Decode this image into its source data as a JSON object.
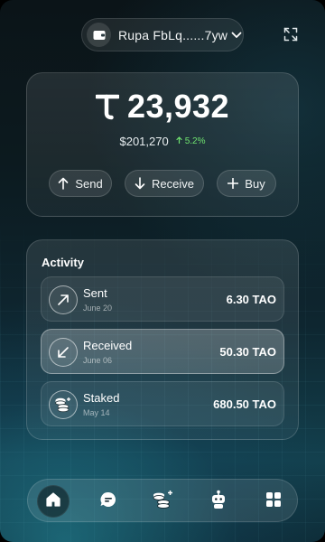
{
  "header": {
    "wallet_name": "Rupa FbLq......7yw"
  },
  "balance": {
    "amount": "23,932",
    "fiat": "$201,270",
    "change": "5.2%",
    "change_color": "#6fe36f"
  },
  "actions": {
    "send": "Send",
    "receive": "Receive",
    "buy": "Buy"
  },
  "activity": {
    "title": "Activity",
    "items": [
      {
        "type": "Sent",
        "date": "June 20",
        "amount": "6.30 TAO",
        "icon": "arrow-up-right-icon"
      },
      {
        "type": "Received",
        "date": "June 06",
        "amount": "50.30 TAO",
        "icon": "arrow-down-left-icon",
        "selected": true
      },
      {
        "type": "Staked",
        "date": "May 14",
        "amount": "680.50 TAO",
        "icon": "coins-stack-icon"
      }
    ]
  },
  "nav": {
    "items": [
      "home-icon",
      "chat-icon",
      "stake-icon",
      "bot-icon",
      "apps-grid-icon"
    ],
    "active": "home-icon"
  }
}
